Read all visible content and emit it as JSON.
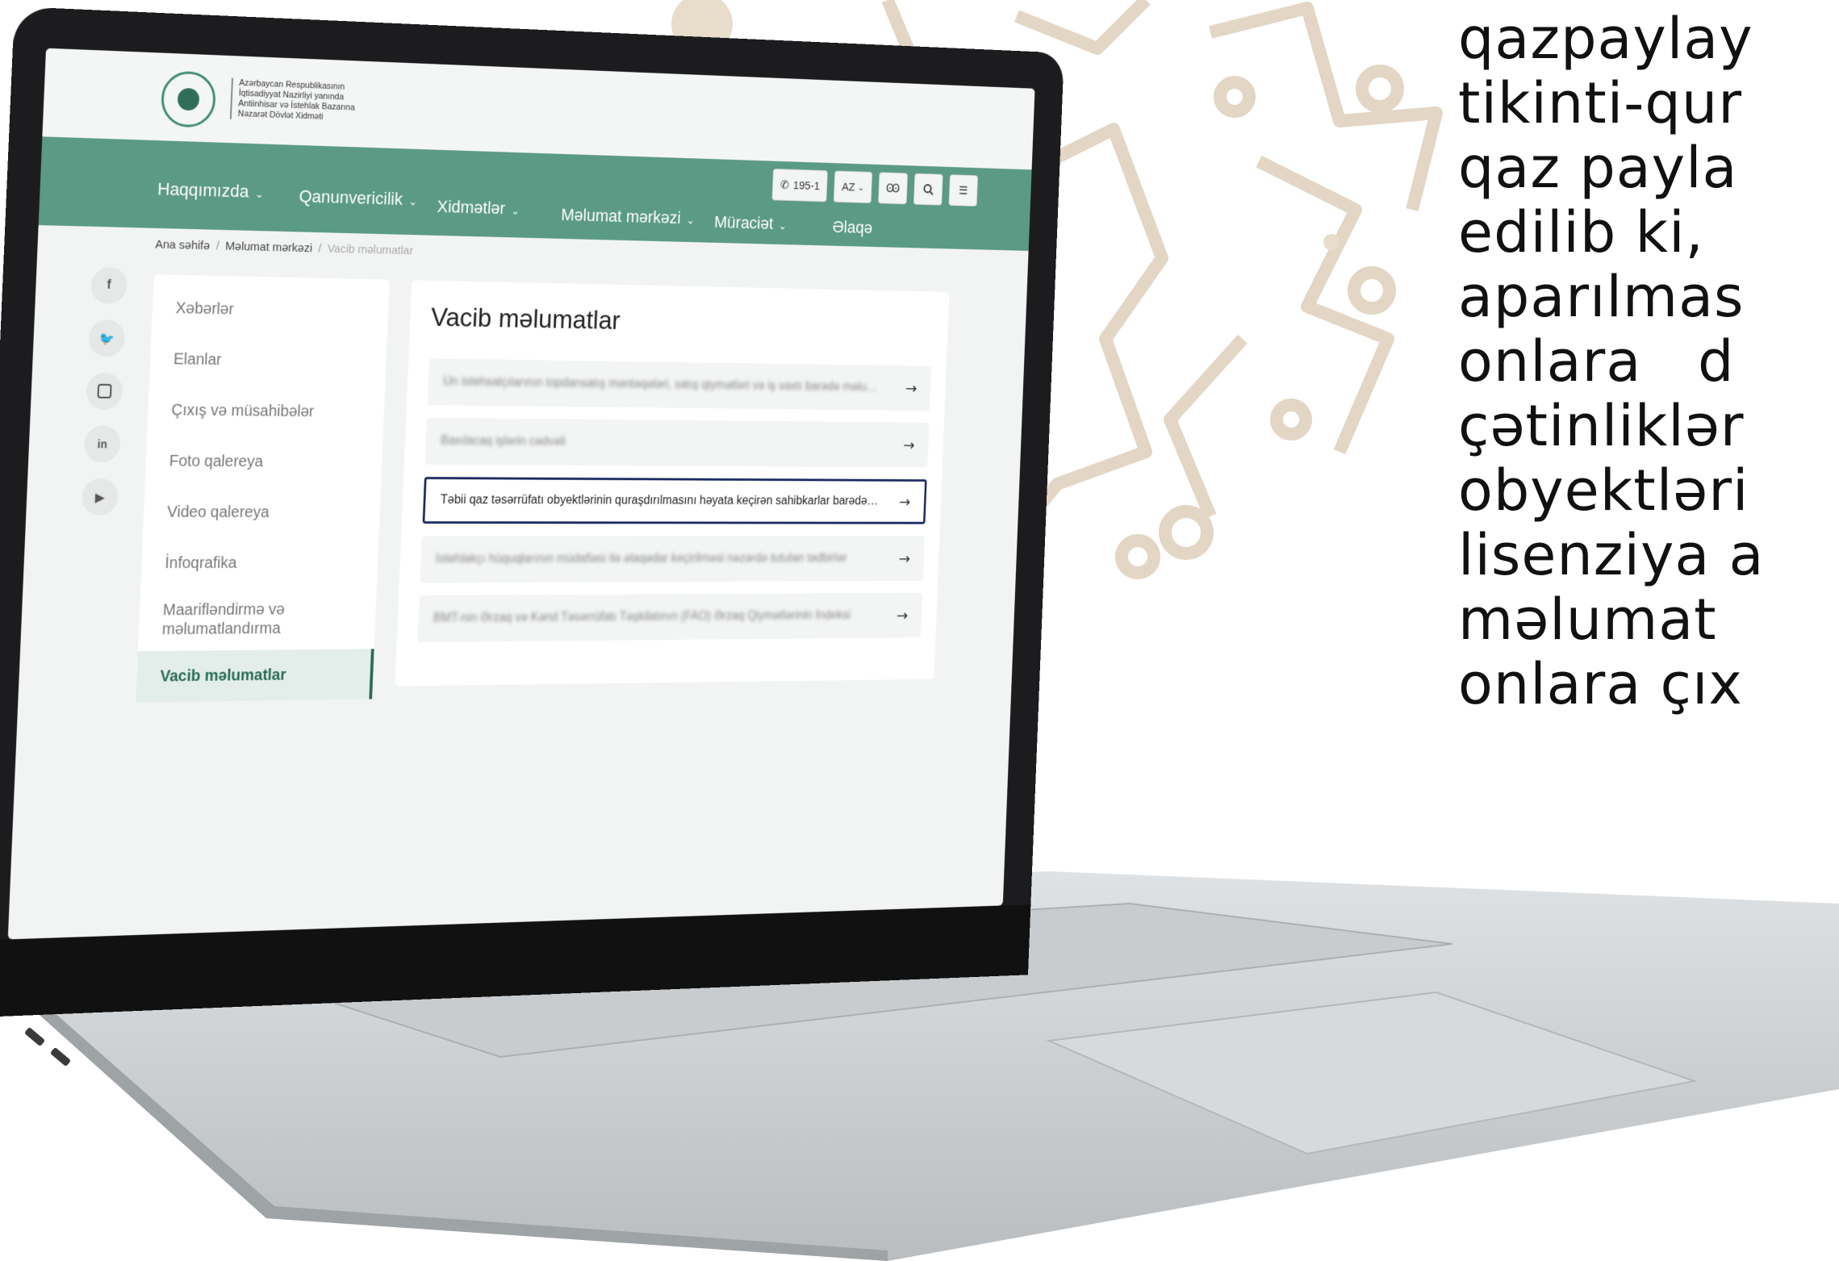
{
  "side_text": [
    "qazpaylay",
    "tikinti-qur",
    "qaz payla",
    "edilib ki,",
    "aparılmas",
    "onlara   d",
    "çətinliklər",
    "obyektləri",
    "lisenziya a",
    "məlumat",
    "onlara çıx"
  ],
  "site": {
    "org_name": "Azərbaycan Respublikasının\nİqtisadiyyat Nazirliyi yanında\nAntiinhisar və İstehlak Bazarına\nNəzarət Dövlət Xidməti",
    "nav": {
      "about": "Haqqımızda",
      "legislation": "Qanunvericilik",
      "services": "Xidmətlər",
      "info_center": "Məlumat mərkəzi",
      "appeal": "Müraciət",
      "contact": "Əlaqə"
    },
    "tools": {
      "phone": "195-1",
      "lang": "AZ",
      "accessibility": "Ꙭ"
    },
    "breadcrumb": {
      "home": "Ana səhifə",
      "section": "Məlumat mərkəzi",
      "current": "Vacib məlumatlar"
    },
    "sidebar": [
      "Xəbərlər",
      "Elanlar",
      "Çıxış və müsahibələr",
      "Foto qalereya",
      "Video qalereya",
      "İnfoqrafika",
      "Maarifləndirmə və məlumatlandırma",
      "Vacib məlumatlar"
    ],
    "content": {
      "title": "Vacib məlumatlar",
      "rows": [
        "Un istehsalçılarının topdansatış məntəqələri, satış qiymətləri və iş vaxtı barədə məlumat",
        "Baxılacaq işlərin cədvəli",
        "Təbii qaz təsərrüfatı obyektlərinin quraşdırılmasını həyata keçirən sahibkarlar barədə məlumatlar",
        "İstehlakçı hüquqlarının müdafiəsi ilə əlaqədar keçirilməsi nəzərdə tutulan tədbirlər",
        "BMT-nin Ərzaq və Kənd Təsərrüfatı Təşkilatının (FAO) Ərzaq Qiymətlərinin İndeksi"
      ],
      "arrow": "→"
    }
  },
  "colors": {
    "nav_green": "#5b9a84",
    "active_green": "#2b6b57",
    "highlight_border": "#1b2b60",
    "ornament_beige": "#e3d6c4"
  }
}
